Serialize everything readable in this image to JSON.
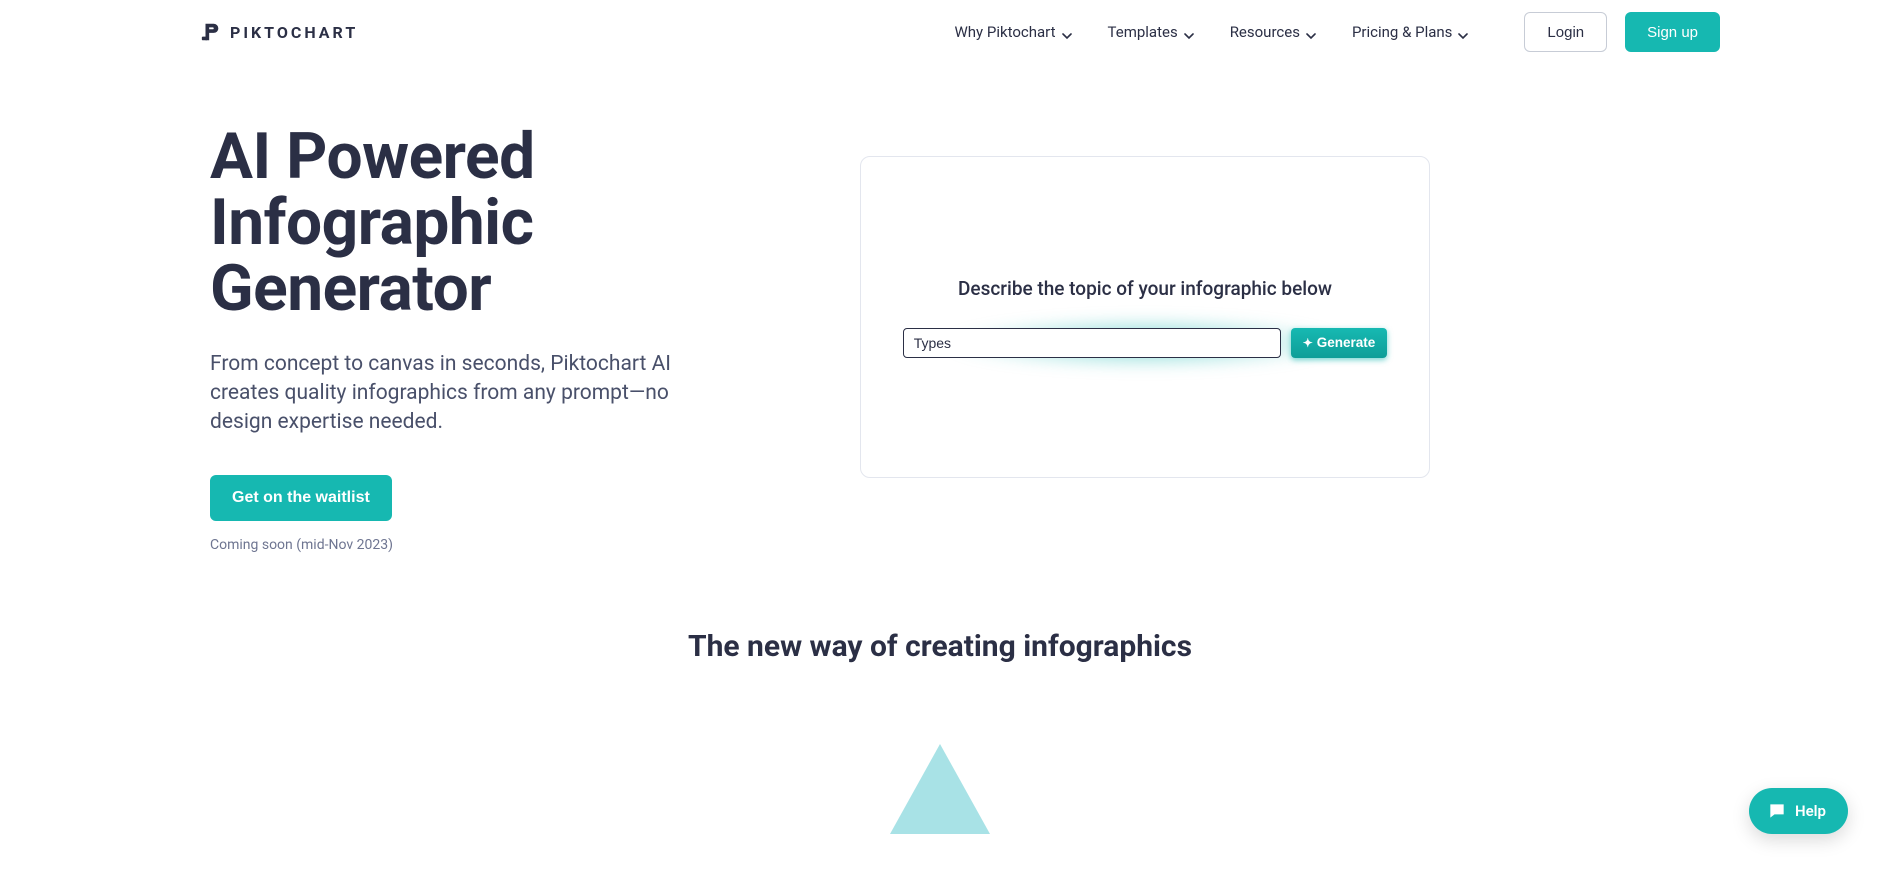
{
  "brand": {
    "name": "PIKTOCHART"
  },
  "nav": {
    "items": [
      {
        "label": "Why Piktochart"
      },
      {
        "label": "Templates"
      },
      {
        "label": "Resources"
      },
      {
        "label": "Pricing & Plans"
      }
    ]
  },
  "auth": {
    "login": "Login",
    "signup": "Sign up"
  },
  "hero": {
    "title_line1": "AI Powered",
    "title_line2": "Infographic",
    "title_line3": "Generator",
    "subtitle": "From concept to canvas in seconds, Piktochart AI creates quality infographics from any prompt—no design expertise needed.",
    "waitlist_button": "Get on the waitlist",
    "coming_soon": "Coming soon (mid-Nov 2023)"
  },
  "panel": {
    "prompt_title": "Describe the topic of your infographic below",
    "input_value": "Types",
    "generate_label": "Generate"
  },
  "section2": {
    "title": "The new way of creating infographics"
  },
  "help": {
    "label": "Help"
  },
  "colors": {
    "accent": "#16b8b1",
    "text_dark": "#2b2f45",
    "text_muted": "#49506a"
  }
}
